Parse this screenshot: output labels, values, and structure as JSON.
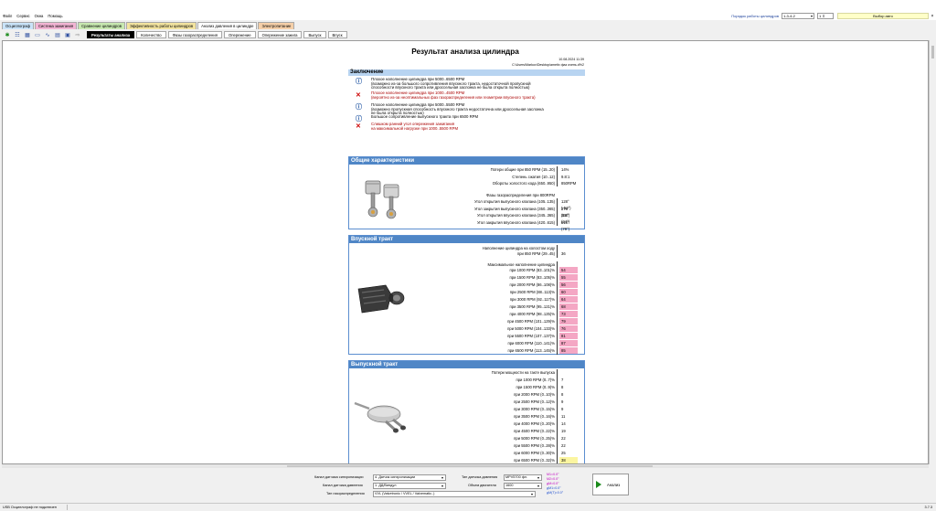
{
  "menu": [
    "Файл",
    "Сервис",
    "Окна",
    "Помощь"
  ],
  "topbar": {
    "firing_order_label": "Порядок работы цилиндров",
    "firing_order_value": "1-3-4-2",
    "cyl_count": "1",
    "engine_select": "Выбор авто",
    "close": "×"
  },
  "tabs": [
    {
      "label": "Осциллограф",
      "bg": "#c9e3f8"
    },
    {
      "label": "Система зажигания",
      "bg": "#f2b5d4"
    },
    {
      "label": "Сравнение цилиндров",
      "bg": "#c7e8b0"
    },
    {
      "label": "Эффективность работы цилиндров",
      "bg": "#f2e39f"
    },
    {
      "label": "Анализ давления в цилиндре",
      "bg": "#ffffff"
    },
    {
      "label": "Электропитание",
      "bg": "#f5cfa8"
    }
  ],
  "subtabs": [
    "Результаты анализа",
    "Количество",
    "Фазы газораспределения",
    "Опережение",
    "Опережение зажига",
    "Выпуск",
    "Впуск"
  ],
  "report": {
    "title": "Результат анализа цилиндра",
    "date": "10.08.2024 11:39",
    "path": "C:\\Users\\Markov\\Desktop\\ametix фаз очень.d%2",
    "conclusion_header": "Заключение",
    "conclusions": [
      {
        "type": "info",
        "l1": "Плохое наполнение цилиндра при 5000..6500 RPM",
        "l2": "(возможно из-за большого сопротивления впускного тракта, недостаточной пропускной",
        "l3": "способности впускного тракта или дроссельная заслонка не была открыта полностью)"
      },
      {
        "type": "err",
        "l1": "Плохое наполнение цилиндра при 1000..4500 RPM",
        "l2": "(вероятно из-за неоптимальных фаз газораспределения или геометрии впускного тракта)",
        "l3": ""
      },
      {
        "type": "info",
        "l1": "Плохое наполнение цилиндра при 5000..5500 RPM",
        "l2": "(возможно пропускная способность впускного тракта недостаточна или дроссельная заслонка",
        "l3": "не была открыта полностью)"
      },
      {
        "type": "info",
        "l1": "Большое сопротивление выпускного тракта при 6500 RPM",
        "l2": "",
        "l3": ""
      },
      {
        "type": "err",
        "l1": "Слишком ранний угол опережения зажигания",
        "l2": " на максимальной нагрузке при 1000..5500 RPM",
        "l3": ""
      }
    ],
    "general": {
      "header": "Общие характеристики",
      "rows": [
        {
          "label": "Потери общие при 850 RPM (15..20)",
          "value": "14%"
        },
        {
          "label": "Степень сжатия (10..12)",
          "value": "9.8:1"
        },
        {
          "label": "Обороты холостого хода (650..950)",
          "value": "850RPM"
        }
      ],
      "phases_title": "Фазы газораспределения при 800RPM",
      "phases": [
        {
          "label": "Угол открытия выпускного клапана (105..135)",
          "value": "128° (-51°)"
        },
        {
          "label": "Угол закрытия выпускного клапана (350..365)",
          "value": "378° (18°)"
        },
        {
          "label": "Угол открытия впускного клапана (345..365)",
          "value": "364° (24°)"
        },
        {
          "label": "Угол закрытия впускного клапана (420..615)",
          "value": "618° (79°)"
        }
      ]
    },
    "intake": {
      "header": "Впускной тракт",
      "idle_l1": "Наполнение цилиндра на холостом ходу",
      "idle_l2": "при 850 RPM (29..45)",
      "idle_value": "36",
      "max_title": "Максимальное наполнение цилиндра",
      "rows": [
        {
          "label": "при 1000 RPM (83..101)%",
          "value": "54"
        },
        {
          "label": "при 1500 RPM (83..105)%",
          "value": "55"
        },
        {
          "label": "при 2000 RPM (86..108)%",
          "value": "56"
        },
        {
          "label": "при 2500 RPM (88..113)%",
          "value": "60"
        },
        {
          "label": "при 3000 RPM (92..117)%",
          "value": "64"
        },
        {
          "label": "при 3500 RPM (95..121)%",
          "value": "68"
        },
        {
          "label": "при 4000 RPM (98..125)%",
          "value": "73"
        },
        {
          "label": "при 4500 RPM (101..129)%",
          "value": "79"
        },
        {
          "label": "при 5000 RPM (104..133)%",
          "value": "76"
        },
        {
          "label": "при 5500 RPM (107..137)%",
          "value": "81"
        },
        {
          "label": "при 6000 RPM (110..141)%",
          "value": "87"
        },
        {
          "label": "при 6500 RPM (113..145)%",
          "value": "85"
        }
      ]
    },
    "exhaust": {
      "header": "Выпускной тракт",
      "title": "Потери мощности на такте выпуска",
      "rows": [
        {
          "label": "при 1000 RPM (0..7)%",
          "value": "7",
          "hl": false
        },
        {
          "label": "при 1500 RPM (0..9)%",
          "value": "8",
          "hl": false
        },
        {
          "label": "при 2000 RPM (0..10)%",
          "value": "8",
          "hl": false
        },
        {
          "label": "при 2500 RPM (0..12)%",
          "value": "9",
          "hl": false
        },
        {
          "label": "при 3000 RPM (0..15)%",
          "value": "9",
          "hl": false
        },
        {
          "label": "при 3500 RPM (0..16)%",
          "value": "11",
          "hl": false
        },
        {
          "label": "при 4000 RPM (0..20)%",
          "value": "14",
          "hl": false
        },
        {
          "label": "при 4500 RPM (0..22)%",
          "value": "19",
          "hl": false
        },
        {
          "label": "при 5000 RPM (0..25)%",
          "value": "22",
          "hl": false
        },
        {
          "label": "при 5500 RPM (0..28)%",
          "value": "22",
          "hl": false
        },
        {
          "label": "при 6000 RPM (0..30)%",
          "value": "25",
          "hl": false
        },
        {
          "label": "при 6500 RPM (0..32)%",
          "value": "38",
          "hl": true
        }
      ]
    }
  },
  "bottom": {
    "sync_label": "Канал датчика синхронизации",
    "sync_value": "4. Датчик синхронизации",
    "pressure_label": "Канал датчика давления",
    "pressure_value": "1. ДД/Виндул",
    "timing_label": "Тип газораспределения",
    "timing_value": "VVL (Valvetronic / VVEL / Valvematic..)",
    "sensor_type_label": "Тип датчика давления",
    "sensor_type_value": "MPV5700 фл.",
    "volume_label": "Объем двигателя",
    "volume_value": "1600",
    "colors": [
      {
        "text": "M1=0.0°",
        "color": "#c000c0"
      },
      {
        "text": "M2=0.0°",
        "color": "#c000c0"
      },
      {
        "text": "дM=0.0°",
        "color": "#c000c0"
      },
      {
        "text": "дM1=0.0°",
        "color": "#2050d0"
      },
      {
        "text": "дМ(T)=0.0°",
        "color": "#2050d0"
      }
    ],
    "analyze": "Анализ"
  },
  "status": {
    "left": "USB Осциллограф не подключен",
    "version": "3.7.3"
  }
}
